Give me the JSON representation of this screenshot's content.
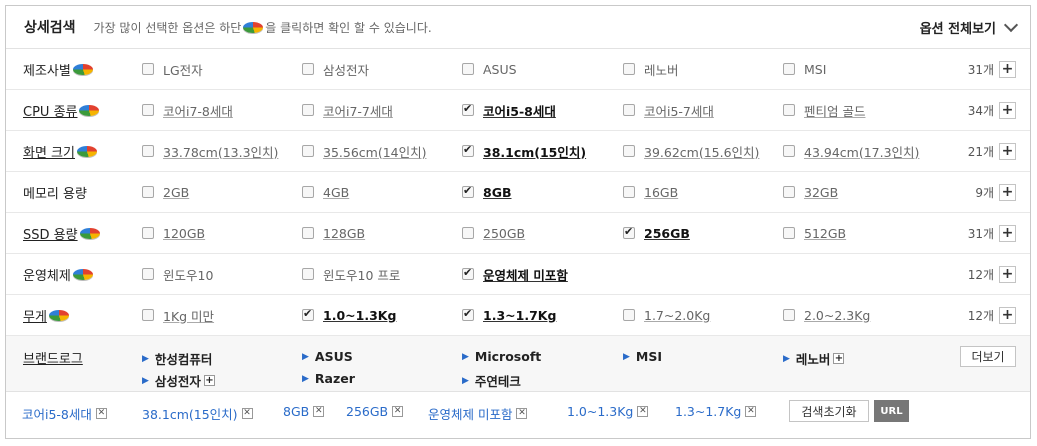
{
  "header": {
    "title": "상세검색",
    "desc_before": "가장 많이 선택한 옵션은 하단",
    "desc_after": "을 클릭하면 확인 할 수 있습니다.",
    "view_all": "옵션 전체보기"
  },
  "rows": [
    {
      "label": "제조사별",
      "count": "31개",
      "options": [
        {
          "text": "LG전자",
          "checked": false
        },
        {
          "text": "삼성전자",
          "checked": false
        },
        {
          "text": "ASUS",
          "checked": false
        },
        {
          "text": "레노버",
          "checked": false
        },
        {
          "text": "MSI",
          "checked": false
        }
      ]
    },
    {
      "label": "CPU 종류",
      "count": "34개",
      "options": [
        {
          "text": "코어i7-8세대",
          "checked": false
        },
        {
          "text": "코어i7-7세대",
          "checked": false
        },
        {
          "text": "코어i5-8세대",
          "checked": true
        },
        {
          "text": "코어i5-7세대",
          "checked": false
        },
        {
          "text": "펜티엄 골드",
          "checked": false
        }
      ]
    },
    {
      "label": "화면 크기",
      "count": "21개",
      "options": [
        {
          "text": "33.78cm(13.3인치)",
          "checked": false
        },
        {
          "text": "35.56cm(14인치)",
          "checked": false
        },
        {
          "text": "38.1cm(15인치)",
          "checked": true
        },
        {
          "text": "39.62cm(15.6인치)",
          "checked": false
        },
        {
          "text": "43.94cm(17.3인치)",
          "checked": false
        }
      ]
    },
    {
      "label": "메모리 용량",
      "count": "9개",
      "options": [
        {
          "text": "2GB",
          "checked": false
        },
        {
          "text": "4GB",
          "checked": false
        },
        {
          "text": "8GB",
          "checked": true
        },
        {
          "text": "16GB",
          "checked": false
        },
        {
          "text": "32GB",
          "checked": false
        }
      ]
    },
    {
      "label": "SSD 용량",
      "count": "31개",
      "options": [
        {
          "text": "120GB",
          "checked": false
        },
        {
          "text": "128GB",
          "checked": false
        },
        {
          "text": "250GB",
          "checked": false
        },
        {
          "text": "256GB",
          "checked": true
        },
        {
          "text": "512GB",
          "checked": false
        }
      ]
    },
    {
      "label": "운영체제",
      "count": "12개",
      "options": [
        {
          "text": "윈도우10",
          "checked": false
        },
        {
          "text": "윈도우10 프로",
          "checked": false
        },
        {
          "text": "운영체제 미포함",
          "checked": true
        }
      ]
    },
    {
      "label": "무게",
      "count": "12개",
      "options": [
        {
          "text": "1Kg 미만",
          "checked": false
        },
        {
          "text": "1.0~1.3Kg",
          "checked": true
        },
        {
          "text": "1.3~1.7Kg",
          "checked": true
        },
        {
          "text": "1.7~2.0Kg",
          "checked": false
        },
        {
          "text": "2.0~2.3Kg",
          "checked": false
        }
      ]
    }
  ],
  "brand_log": {
    "label": "브랜드로그",
    "more": "더보기",
    "brands": [
      "한성컴퓨터",
      "ASUS",
      "Microsoft",
      "MSI",
      "레노버",
      "삼성전자",
      "Razer",
      "주연테크"
    ]
  },
  "selected_tags": [
    "코어i5-8세대",
    "38.1cm(15인치)",
    "8GB",
    "256GB",
    "운영체제 미포함",
    "1.0~1.3Kg",
    "1.3~1.7Kg"
  ],
  "reset_label": "검색초기화",
  "url_label": "URL"
}
